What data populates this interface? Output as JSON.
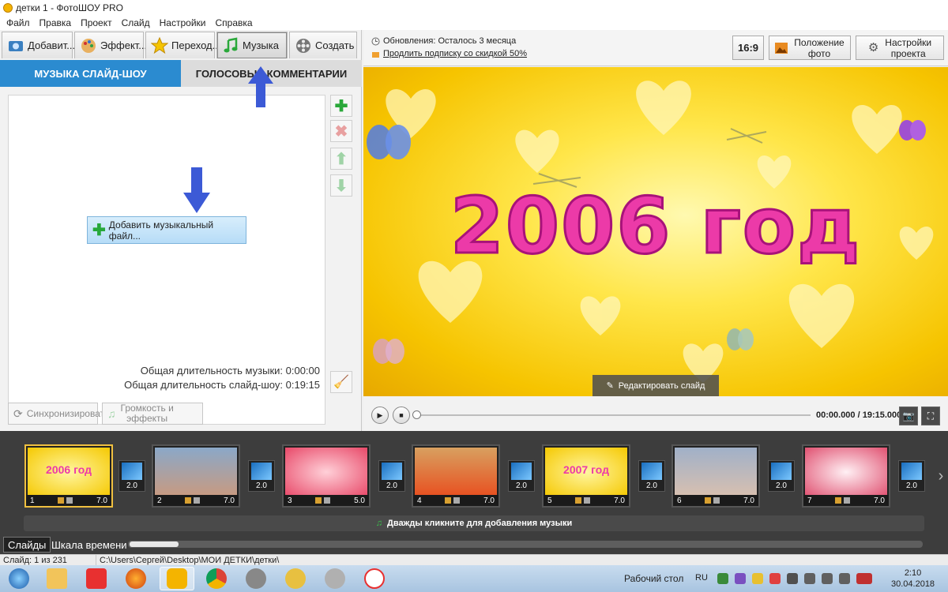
{
  "window": {
    "title": "детки 1 - ФотоШОУ PRO"
  },
  "menu": [
    "Файл",
    "Правка",
    "Проект",
    "Слайд",
    "Настройки",
    "Справка"
  ],
  "tabs": [
    {
      "label": "Добавит...",
      "icon": "photo-icon",
      "active": false
    },
    {
      "label": "Эффект...",
      "icon": "palette-icon",
      "active": false
    },
    {
      "label": "Переход...",
      "icon": "star-icon",
      "active": false
    },
    {
      "label": "Музыка",
      "icon": "music-note-icon",
      "active": true
    },
    {
      "label": "Создать",
      "icon": "film-reel-icon",
      "active": false
    }
  ],
  "subtabs": {
    "music": "МУЗЫКА СЛАЙД-ШОУ",
    "voice": "ГОЛОСОВЫЕ КОММЕНТАРИИ"
  },
  "music_panel": {
    "add_button": "Добавить музыкальный файл...",
    "music_duration": "Общая длительность музыки: 0:00:00",
    "show_duration": "Общая длительность слайд-шоу: 0:19:15",
    "sync_button": "Синхронизировать",
    "volume_button_line1": "Громкость и",
    "volume_button_line2": "эффекты"
  },
  "updates": {
    "remaining": "Обновления: Осталось 3 месяца",
    "renew_link": "Продлить подписку со скидкой 50%"
  },
  "toolbar": {
    "aspect": "16:9",
    "photo_position_line1": "Положение",
    "photo_position_line2": "фото",
    "project_settings_line1": "Настройки",
    "project_settings_line2": "проекта"
  },
  "preview": {
    "slide_title": "2006 год",
    "edit_slide": "Редактировать слайд"
  },
  "player": {
    "time": "00:00.000 / 19:15.000"
  },
  "slides": [
    {
      "num": "1",
      "duration": "7.0",
      "selected": true,
      "caption": "2006 год"
    },
    {
      "num": "2",
      "duration": "7.0",
      "selected": false,
      "caption": ""
    },
    {
      "num": "3",
      "duration": "5.0",
      "selected": false,
      "caption": ""
    },
    {
      "num": "4",
      "duration": "7.0",
      "selected": false,
      "caption": ""
    },
    {
      "num": "5",
      "duration": "7.0",
      "selected": false,
      "caption": "2007 год"
    },
    {
      "num": "6",
      "duration": "7.0",
      "selected": false,
      "caption": ""
    },
    {
      "num": "7",
      "duration": "7.0",
      "selected": false,
      "caption": ""
    }
  ],
  "transitions": [
    "2.0",
    "2.0",
    "2.0",
    "2.0",
    "2.0",
    "2.0",
    "2.0"
  ],
  "filmstrip": {
    "music_hint": "Дважды кликните для добавления музыки"
  },
  "viewtabs": {
    "slides": "Слайды",
    "timeline": "Шкала времени"
  },
  "status": {
    "slide_count": "Слайд: 1 из 231",
    "path": "C:\\Users\\Сергей\\Desktop\\МОИ ДЕТКИ\\детки\\"
  },
  "taskbar": {
    "desktop": "Рабочий стол",
    "lang": "RU",
    "time": "2:10",
    "date": "30.04.2018"
  },
  "colors": {
    "accent": "#2b8bd0",
    "slide_title": "#ec3aa8",
    "preview_bg": "#ffe64a",
    "filmstrip_bg": "#3d3d3d"
  }
}
